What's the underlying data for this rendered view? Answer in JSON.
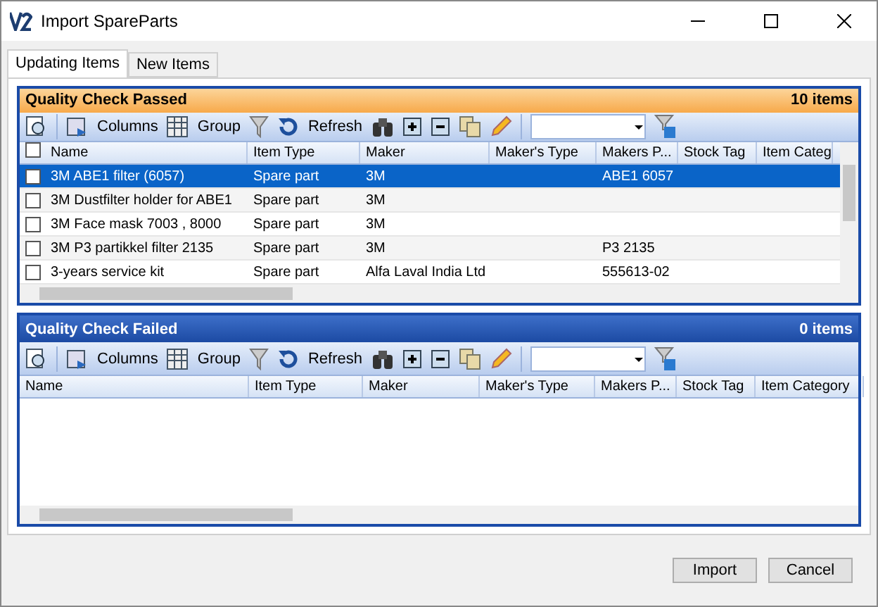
{
  "window": {
    "title": "Import SpareParts"
  },
  "tabs": [
    {
      "label": "Updating Items",
      "selected": true
    },
    {
      "label": "New Items",
      "selected": false
    }
  ],
  "panels": [
    {
      "kind": "passed",
      "title": "Quality Check Passed",
      "count": "10 items",
      "toolbar": {
        "columns": "Columns",
        "group": "Group",
        "refresh": "Refresh"
      },
      "select_all_checked": false,
      "columns": [
        "Name",
        "Item Type",
        "Maker",
        "Maker's Type",
        "Makers P...",
        "Stock Tag",
        "Item Categ"
      ],
      "rows": [
        {
          "checked": false,
          "selected": true,
          "cells": [
            "3M ABE1 filter  (6057)",
            "Spare part",
            "3M",
            "",
            "ABE1 6057",
            "",
            ""
          ]
        },
        {
          "checked": false,
          "selected": false,
          "cells": [
            "3M Dustfilter holder for ABE1",
            "Spare part",
            "3M",
            "",
            "",
            "",
            ""
          ]
        },
        {
          "checked": false,
          "selected": false,
          "cells": [
            "3M Face mask  7003 , 8000",
            "Spare part",
            "3M",
            "",
            "",
            "",
            ""
          ]
        },
        {
          "checked": false,
          "selected": false,
          "cells": [
            "3M P3 partikkel filter  2135",
            "Spare part",
            "3M",
            "",
            "P3 2135",
            "",
            ""
          ]
        },
        {
          "checked": false,
          "selected": false,
          "cells": [
            "3-years service kit",
            "Spare part",
            "Alfa Laval India Ltd",
            "",
            "555613-02",
            "",
            ""
          ]
        }
      ]
    },
    {
      "kind": "failed",
      "title": "Quality Check Failed",
      "count": "0 items",
      "toolbar": {
        "columns": "Columns",
        "group": "Group",
        "refresh": "Refresh"
      },
      "columns": [
        "Name",
        "Item Type",
        "Maker",
        "Maker's Type",
        "Makers P...",
        "Stock Tag",
        "Item Category"
      ]
    }
  ],
  "buttons": [
    "Import",
    "Cancel"
  ]
}
